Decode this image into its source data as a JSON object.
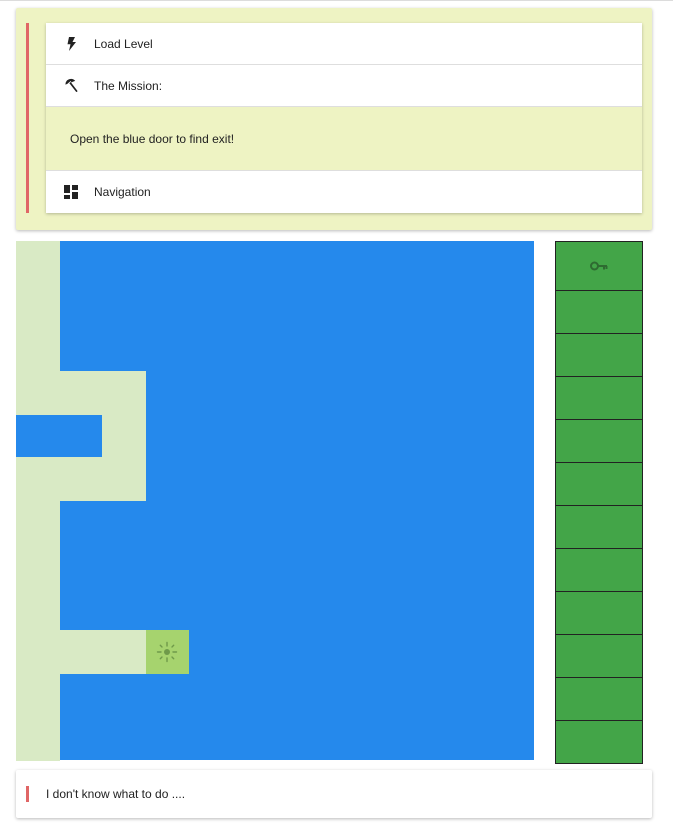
{
  "menu": {
    "load_level": {
      "label": "Load Level",
      "icon": "lightning-bolt-icon"
    },
    "mission": {
      "label": "The Mission:",
      "icon": "beach-umbrella-icon"
    },
    "mission_text": "Open the blue door to find exit!",
    "navigation": {
      "label": "Navigation",
      "icon": "dashboard-icon"
    }
  },
  "board": {
    "columns": 12,
    "rows": 12,
    "wall_color": "#2589ec",
    "floor_color": "#d9eac5",
    "player_color": "#a6d36e",
    "floor_tiles": [
      [
        0,
        0
      ],
      [
        0,
        1
      ],
      [
        0,
        2
      ],
      [
        0,
        3
      ],
      [
        1,
        3
      ],
      [
        2,
        3
      ],
      [
        2,
        4
      ],
      [
        0,
        5
      ],
      [
        1,
        5
      ],
      [
        2,
        5
      ],
      [
        0,
        6
      ],
      [
        0,
        7
      ],
      [
        0,
        8
      ],
      [
        0,
        9
      ],
      [
        1,
        9
      ],
      [
        2,
        9
      ],
      [
        0,
        10
      ],
      [
        0,
        11
      ]
    ],
    "player": {
      "col": 3,
      "row": 9,
      "icon": "sun-icon"
    }
  },
  "inventory": {
    "slot_color": "#43a548",
    "slots": [
      "key-icon",
      "",
      "",
      "",
      "",
      "",
      "",
      "",
      "",
      "",
      "",
      ""
    ]
  },
  "message": "I don't know what to do ...."
}
